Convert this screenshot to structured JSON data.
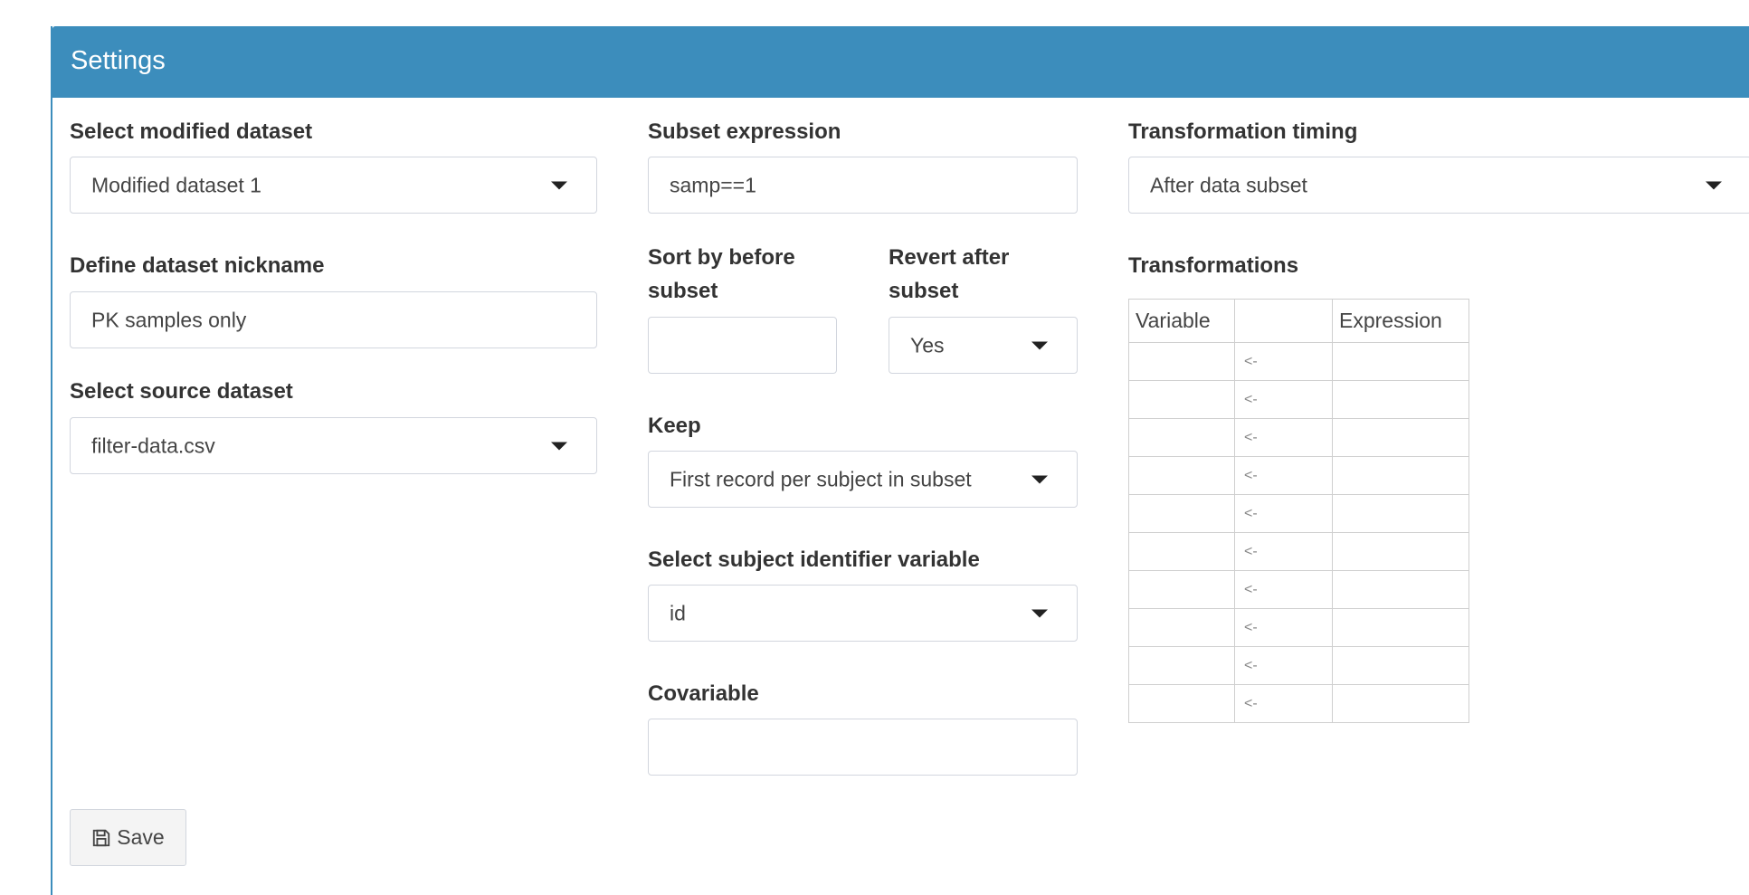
{
  "panel": {
    "title": "Settings"
  },
  "col1": {
    "select_dataset": {
      "label": "Select modified dataset",
      "value": "Modified dataset 1"
    },
    "nickname": {
      "label": "Define dataset nickname",
      "value": "PK samples only"
    },
    "source": {
      "label": "Select source dataset",
      "value": "filter-data.csv"
    }
  },
  "col2": {
    "subset": {
      "label": "Subset expression",
      "value": "samp==1"
    },
    "sort": {
      "label_line1": "Sort by before",
      "label_line2": "subset",
      "value": ""
    },
    "revert": {
      "label_line1": "Revert after",
      "label_line2": "subset",
      "value": "Yes"
    },
    "keep": {
      "label": "Keep",
      "value": "First record per subject in subset"
    },
    "subject": {
      "label": "Select subject identifier variable",
      "value": "id"
    },
    "covariable": {
      "label": "Covariable",
      "value": ""
    }
  },
  "col3": {
    "timing": {
      "label": "Transformation timing",
      "value": "After data subset"
    },
    "transformations": {
      "label": "Transformations",
      "headers": [
        "Variable",
        "",
        "Expression"
      ],
      "rows": [
        {
          "variable": "",
          "op": "<-",
          "expression": ""
        },
        {
          "variable": "",
          "op": "<-",
          "expression": ""
        },
        {
          "variable": "",
          "op": "<-",
          "expression": ""
        },
        {
          "variable": "",
          "op": "<-",
          "expression": ""
        },
        {
          "variable": "",
          "op": "<-",
          "expression": ""
        },
        {
          "variable": "",
          "op": "<-",
          "expression": ""
        },
        {
          "variable": "",
          "op": "<-",
          "expression": ""
        },
        {
          "variable": "",
          "op": "<-",
          "expression": ""
        },
        {
          "variable": "",
          "op": "<-",
          "expression": ""
        },
        {
          "variable": "",
          "op": "<-",
          "expression": ""
        }
      ]
    }
  },
  "save_button": {
    "label": "Save",
    "icon": "floppy-disk-icon"
  },
  "colors": {
    "header": "#3c8dbc",
    "border": "#d2d6de"
  }
}
